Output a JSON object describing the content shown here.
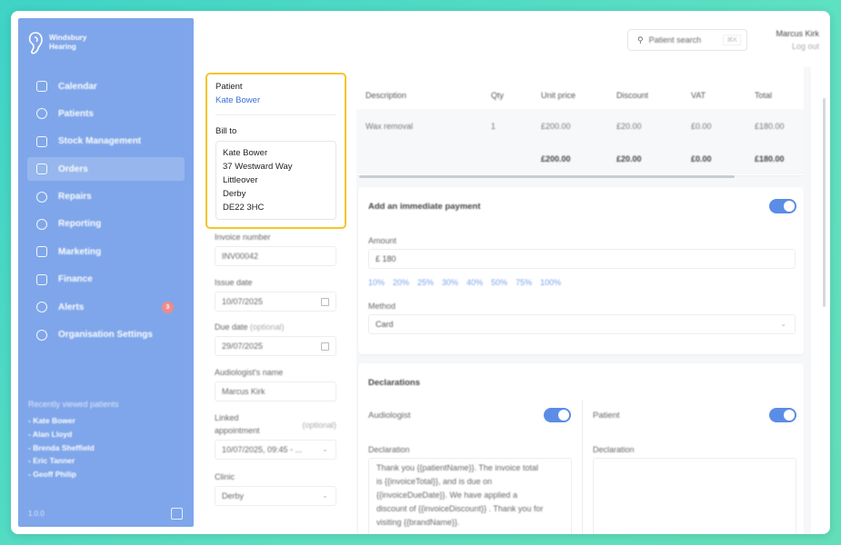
{
  "brand": {
    "line1": "Windsbury",
    "line2": "Hearing"
  },
  "nav": [
    {
      "label": "Calendar",
      "icon": "calendar-icon"
    },
    {
      "label": "Patients",
      "icon": "patients-icon"
    },
    {
      "label": "Stock Management",
      "icon": "clipboard-icon"
    },
    {
      "label": "Orders",
      "icon": "orders-icon",
      "active": true
    },
    {
      "label": "Repairs",
      "icon": "wrench-icon"
    },
    {
      "label": "Reporting",
      "icon": "chart-icon"
    },
    {
      "label": "Marketing",
      "icon": "mail-icon"
    },
    {
      "label": "Finance",
      "icon": "card-icon"
    },
    {
      "label": "Alerts",
      "icon": "bell-icon",
      "badge": "3"
    },
    {
      "label": "Organisation Settings",
      "icon": "gear-icon"
    }
  ],
  "recent": {
    "title": "Recently viewed patients",
    "items": [
      "- Kate Bower",
      "- Alan Lloyd",
      "- Brenda Sheffield",
      "- Eric Tanner",
      "- Geoff Philip"
    ]
  },
  "version": "1.0.0",
  "search": {
    "label": "Patient search",
    "shortcut": "⌘K"
  },
  "user": {
    "name": "Marcus Kirk",
    "logout": "Log out"
  },
  "patient": {
    "label": "Patient",
    "name": "Kate Bower",
    "bill_to_label": "Bill to",
    "address": [
      "Kate Bower",
      "37 Westward Way",
      "Littleover",
      "Derby",
      "DE22 3HC"
    ]
  },
  "form": {
    "invoice_number": {
      "label": "Invoice number",
      "value": "INV00042"
    },
    "issue_date": {
      "label": "Issue date",
      "value": "10/07/2025"
    },
    "due_date": {
      "label": "Due date",
      "optional": "(optional)",
      "value": "29/07/2025"
    },
    "audiologist": {
      "label": "Audiologist's name",
      "value": "Marcus Kirk"
    },
    "linked": {
      "label1": "Linked",
      "label2": "appointment",
      "optional": "(optional)",
      "value": "10/07/2025, 09:45 - ..."
    },
    "clinic": {
      "label": "Clinic",
      "value": "Derby"
    }
  },
  "table": {
    "headers": [
      "Description",
      "Qty",
      "Unit price",
      "Discount",
      "VAT",
      "Total"
    ],
    "row": [
      "Wax removal",
      "1",
      "£200.00",
      "£20.00",
      "£0.00",
      "£180.00"
    ],
    "totals": [
      "",
      "",
      "£200.00",
      "£20.00",
      "£0.00",
      "£180.00"
    ]
  },
  "payment": {
    "title": "Add an immediate payment",
    "amount_label": "Amount",
    "amount_value": "£ 180",
    "percents": [
      "10%",
      "20%",
      "25%",
      "30%",
      "40%",
      "50%",
      "75%",
      "100%"
    ],
    "method_label": "Method",
    "method_value": "Card"
  },
  "declarations": {
    "title": "Declarations",
    "audiologist_label": "Audiologist",
    "patient_label": "Patient",
    "declaration_label": "Declaration",
    "declaration_label_2": "Declaration",
    "text": [
      "Thank you {{patientName}}. The invoice total",
      "is {{invoiceTotal}}, and is due on",
      "{{invoiceDueDate}}. We have applied a",
      "discount of {{invoiceDiscount}} . Thank you for",
      "visiting {{brandName}}."
    ]
  },
  "colors": {
    "sidebar": "#7fa6ea",
    "highlight": "#f4c52a",
    "accent": "#5b8de6",
    "link": "#3a6fd8"
  }
}
